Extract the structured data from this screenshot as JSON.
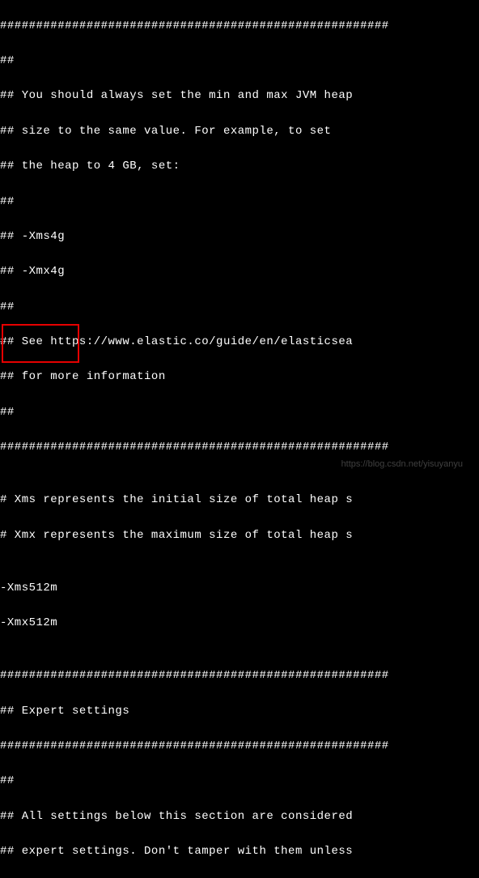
{
  "lines": {
    "l0": "######################################################",
    "l1": "##",
    "l2": "## You should always set the min and max JVM heap",
    "l3": "## size to the same value. For example, to set",
    "l4": "## the heap to 4 GB, set:",
    "l5": "##",
    "l6": "## -Xms4g",
    "l7": "## -Xmx4g",
    "l8": "##",
    "l9": "## See https://www.elastic.co/guide/en/elasticsea",
    "l10": "## for more information",
    "l11": "##",
    "l12": "######################################################",
    "l13": "",
    "l14": "# Xms represents the initial size of total heap s",
    "l15": "# Xmx represents the maximum size of total heap s",
    "l16": "",
    "l17": "-Xms512m",
    "l18": "-Xmx512m",
    "l19": "",
    "l20": "######################################################",
    "l21": "## Expert settings",
    "l22": "######################################################",
    "l23": "##",
    "l24": "## All settings below this section are considered",
    "l25": "## expert settings. Don't tamper with them unless"
  },
  "watermark": "https://blog.csdn.net/yisuyanyu"
}
